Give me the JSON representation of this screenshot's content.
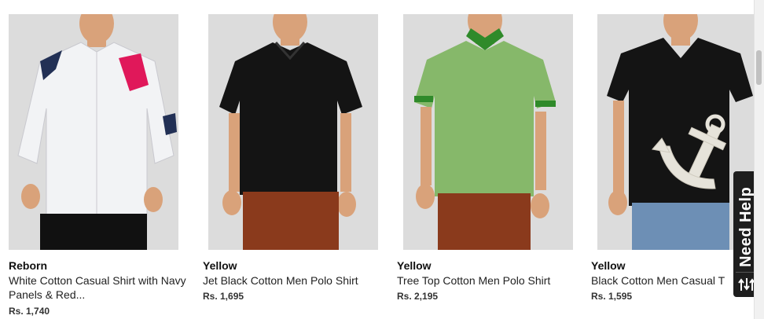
{
  "products": [
    {
      "brand": "Reborn",
      "name": "White Cotton Casual Shirt with Navy Panels & Red...",
      "price": "Rs. 1,740",
      "garment": "white casual shirt with navy and red panels",
      "shirt_color": "#f2f3f5",
      "pant_color": "#111111"
    },
    {
      "brand": "Yellow",
      "name": "Jet Black Cotton Men Polo Shirt",
      "price": "Rs. 1,695",
      "garment": "black polo shirt",
      "shirt_color": "#141414",
      "pant_color": "#8a3a1c"
    },
    {
      "brand": "Yellow",
      "name": "Tree Top Cotton Men Polo Shirt",
      "price": "Rs. 2,195",
      "garment": "green polo shirt",
      "shirt_color": "#86b86a",
      "pant_color": "#8a3a1c"
    },
    {
      "brand": "Yellow",
      "name": "Black Cotton Men Casual T",
      "price": "Rs. 1,595",
      "garment": "black t-shirt with anchor print",
      "shirt_color": "#141414",
      "pant_color": "#6d8fb5"
    }
  ],
  "help_widget": {
    "label": "Need Help",
    "icon": "sort-arrows-icon"
  },
  "colors": {
    "accent_red": "#e0185a",
    "collar_green": "#2f8a2a",
    "photo_bg": "#dcdcdc",
    "skin": "#d9a27a"
  }
}
